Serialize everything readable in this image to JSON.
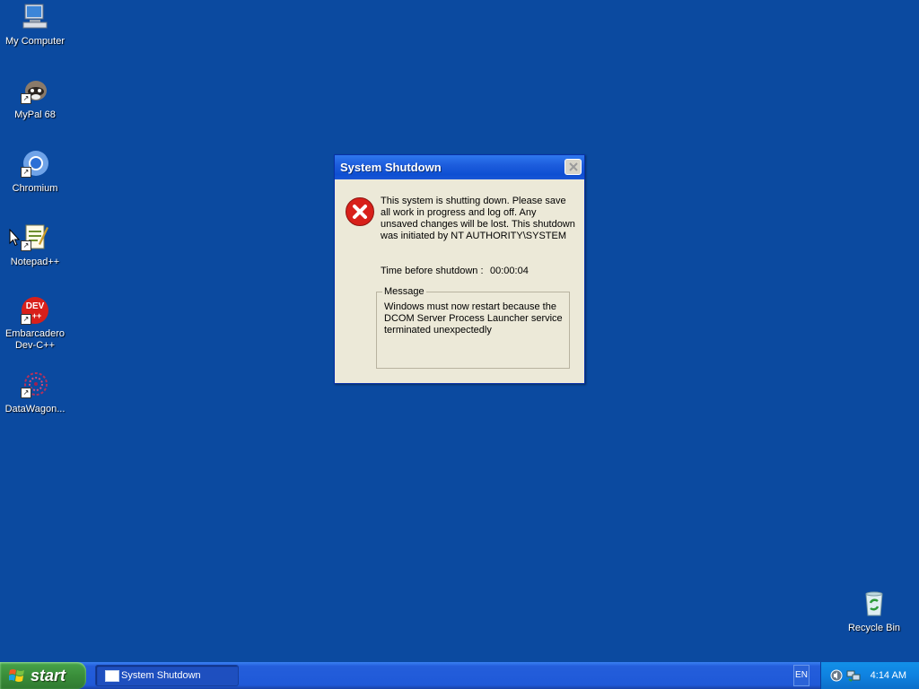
{
  "desktop": {
    "icons": [
      {
        "label": "My Computer",
        "icon": "my-computer-icon"
      },
      {
        "label": "MyPal 68",
        "icon": "mypal-icon"
      },
      {
        "label": "Chromium",
        "icon": "chromium-icon"
      },
      {
        "label": "Notepad++",
        "icon": "notepad-plus-plus-icon"
      },
      {
        "label": "Embarcadero Dev-C++",
        "icon": "devcpp-icon",
        "badge": "DEV"
      },
      {
        "label": "DataWagon...",
        "icon": "datawagon-icon"
      },
      {
        "label": "Recycle Bin",
        "icon": "recycle-bin-icon"
      }
    ]
  },
  "dialog": {
    "title": "System Shutdown",
    "message": "This system is shutting down. Please save all work in progress and log off. Any unsaved changes will be lost. This shutdown was initiated by NT AUTHORITY\\SYSTEM",
    "countdown_label": "Time before shutdown :",
    "countdown_value": "00:00:04",
    "group_label": "Message",
    "group_text": "Windows must now restart because the DCOM Server Process Launcher service terminated unexpectedly"
  },
  "taskbar": {
    "start_label": "start",
    "task_item": "System Shutdown",
    "language": "EN",
    "clock": "4:14 AM"
  },
  "colors": {
    "desktop": "#0b4aa0",
    "title_bar": "#1d5ddd",
    "dialog_bg": "#ece9d8",
    "error_red": "#d8201a",
    "start_green": "#3a8e3a"
  }
}
